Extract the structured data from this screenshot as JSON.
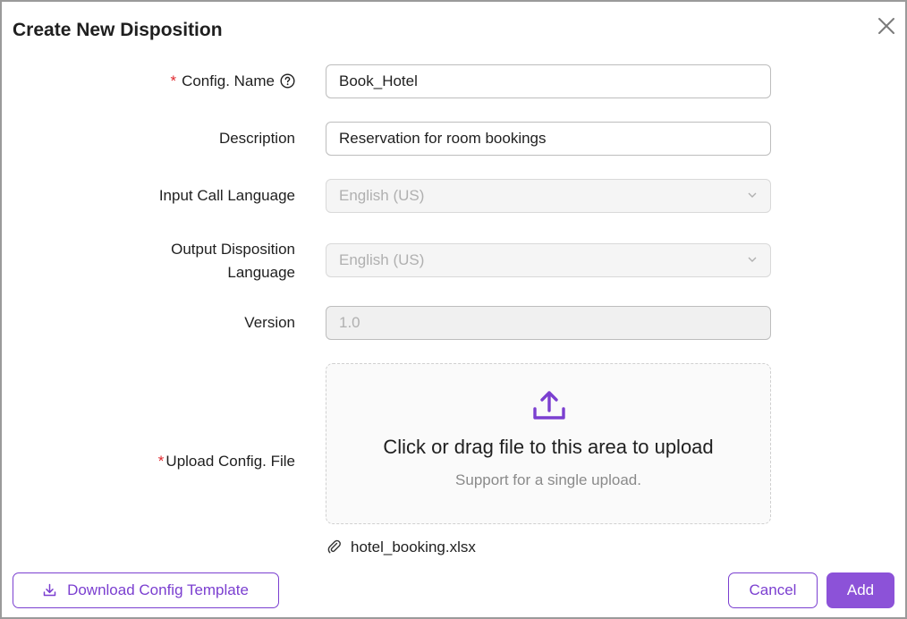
{
  "dialog": {
    "title": "Create New Disposition"
  },
  "form": {
    "config_name": {
      "label": "Config. Name",
      "required_mark": "*",
      "value": "Book_Hotel"
    },
    "description": {
      "label": "Description",
      "value": "Reservation for room bookings"
    },
    "input_language": {
      "label": "Input Call Language",
      "value": "English (US)"
    },
    "output_language": {
      "label_line1": "Output Disposition",
      "label_line2": "Language",
      "value": "English (US)"
    },
    "version": {
      "label": "Version",
      "placeholder": "1.0"
    },
    "upload": {
      "label": "Upload Config. File",
      "required_mark": "*",
      "main_text": "Click or drag file to this area to upload",
      "hint_text": "Support for a single upload.",
      "file_name": "hotel_booking.xlsx"
    }
  },
  "footer": {
    "download_label": "Download Config Template",
    "cancel_label": "Cancel",
    "add_label": "Add"
  },
  "colors": {
    "accent": "#8c52d8",
    "required": "#e0282e"
  },
  "icons": {
    "close": "close-icon",
    "help": "question-circle-icon",
    "dropdown": "chevron-down-icon",
    "upload": "upload-icon",
    "attachment": "paperclip-icon",
    "download": "download-icon"
  }
}
